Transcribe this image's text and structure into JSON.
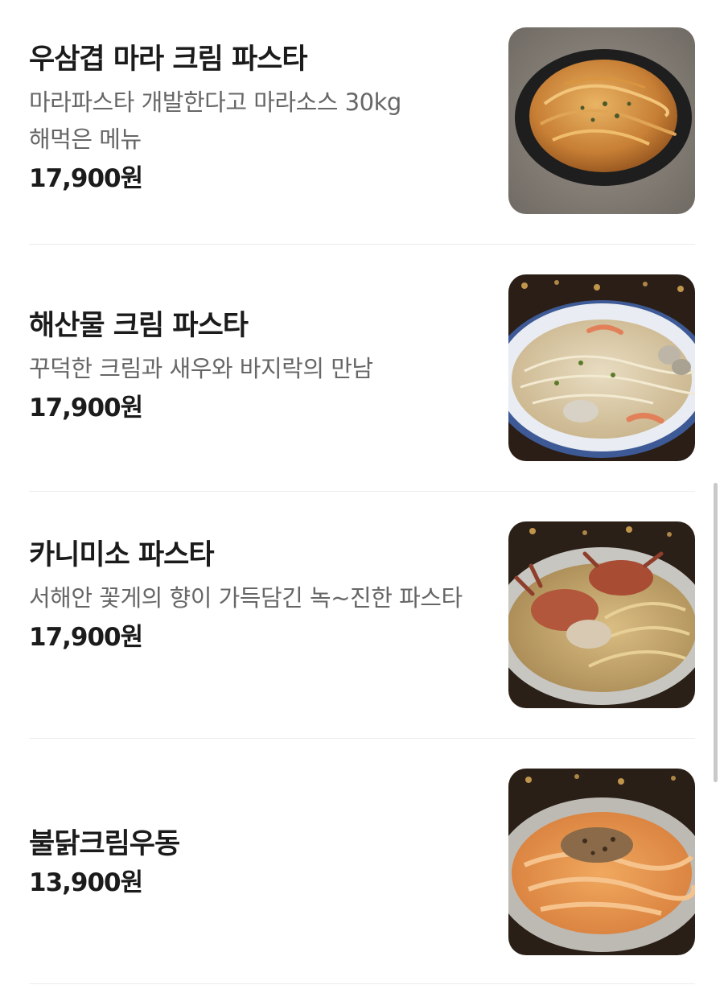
{
  "menu": {
    "items": [
      {
        "name": "우삼겹 마라 크림 파스타",
        "description": "마라파스타 개발한다고 마라소스 30kg 해먹은 메뉴",
        "price": "17,900원",
        "image_icon": "mala-cream-pasta-photo"
      },
      {
        "name": "해산물 크림 파스타",
        "description": "꾸덕한 크림과 새우와 바지락의 만남",
        "price": "17,900원",
        "image_icon": "seafood-cream-pasta-photo"
      },
      {
        "name": "카니미소 파스타",
        "description": "서해안 꽃게의 향이 가득담긴 녹~진한 파스타",
        "price": "17,900원",
        "image_icon": "crab-miso-pasta-photo"
      },
      {
        "name": "불닭크림우동",
        "description": "",
        "price": "13,900원",
        "image_icon": "buldak-cream-udon-photo"
      }
    ]
  },
  "colors": {
    "name_text": "#1b1b1b",
    "description_text": "#666666",
    "divider": "#ececec",
    "scrollbar": "#c9c9c9"
  }
}
